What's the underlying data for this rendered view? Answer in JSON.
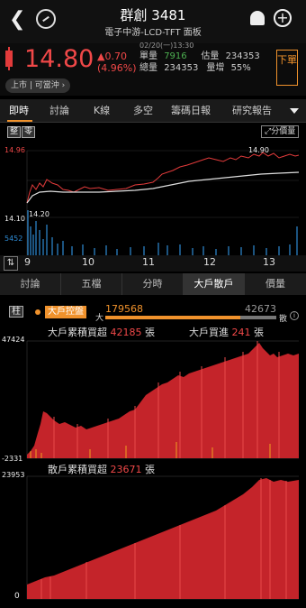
{
  "header": {
    "back_icon": "chevron-left-icon",
    "sync_icon": "sync-icon",
    "title": "群創 3481",
    "subtitle": "電子中游-LCD-TFT 面板",
    "bell_icon": "bell-icon",
    "add_icon": "plus-icon"
  },
  "quote": {
    "price": "14.80",
    "change": "▲0.70",
    "change_pct": "(4.96%)",
    "datetime": "02/20(一)13:30",
    "single_vol_label": "單量",
    "single_vol": "7916",
    "est_vol_label": "估量",
    "est_vol": "234353",
    "total_vol_label": "總量",
    "total_vol": "234353",
    "vol_inc_label": "量增",
    "vol_inc": "55%",
    "order_btn": "下單",
    "market_pill": "上市 | 可當沖"
  },
  "tabs": [
    "即時",
    "討論",
    "K線",
    "多空",
    "籌碼日報",
    "研究報告"
  ],
  "active_tab": 0,
  "chart_controls": {
    "tag1": "整",
    "tag2": "零",
    "price_dist_btn": "分價量"
  },
  "intraday": {
    "high_label": "14.96",
    "peak_label": "14.90",
    "low_label": "14.10",
    "vol_low_label": "14.20",
    "vol_label": "5452",
    "time_ticks": [
      "9",
      "10",
      "11",
      "12",
      "13"
    ]
  },
  "subtabs": [
    "討論",
    "五檔",
    "分時",
    "大戶散戶",
    "價量"
  ],
  "active_subtab": 3,
  "big_holder": {
    "pillar_btn": "柱",
    "control_label": "大戶控盤",
    "big_prefix": "大",
    "big_value": "179568",
    "retail_value": "42673",
    "retail_suffix": "散",
    "big_cum_label": "大戶累積買超",
    "big_cum_value": "42185",
    "big_cum_unit": "張",
    "big_buy_label": "大戶買進",
    "big_buy_value": "241",
    "big_buy_unit": "張",
    "y_max": "47424",
    "y_min": "-2331",
    "retail_cum_label": "散戶累積買超",
    "retail_cum_value": "23671",
    "retail_cum_unit": "張",
    "retail_y_max": "23953",
    "retail_y_min": "0"
  },
  "colors": {
    "up": "#f04848",
    "accent": "#f0922c",
    "vol_bar": "#2e8cd6"
  }
}
